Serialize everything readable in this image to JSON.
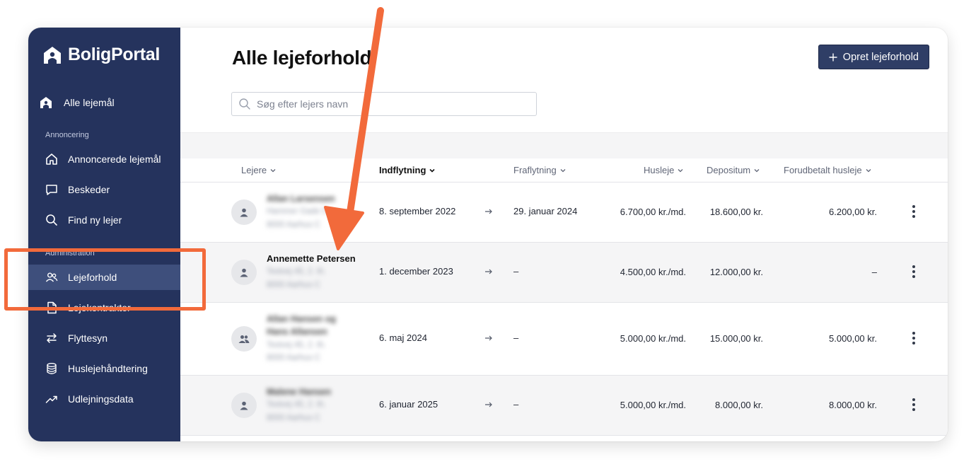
{
  "app": {
    "logo_text": "BoligPortal"
  },
  "sidebar": {
    "top_item": "Alle lejemål",
    "section_1": "Annoncering",
    "section_1_items": [
      "Annoncerede lejemål",
      "Beskeder",
      "Find ny lejer"
    ],
    "section_2": "Administration",
    "section_2_items": [
      "Lejeforhold",
      "Lejekontrakter",
      "Flyttesyn",
      "Huslejehåndtering",
      "Udlejningsdata"
    ]
  },
  "main": {
    "title": "Alle lejeforhold",
    "create_button": "Opret lejeforhold",
    "search_placeholder": "Søg efter lejers navn"
  },
  "table": {
    "columns": [
      "Lejere",
      "Indflytning",
      "Fraflytning",
      "Husleje",
      "Depositum",
      "Forudbetalt husleje"
    ],
    "rows": [
      {
        "name": "Allan Larsensen",
        "address1": "Hammer Gade 5",
        "address2": "8000 Aarhus C",
        "move_in": "8. september 2022",
        "move_out": "29. januar 2024",
        "rent": "6.700,00 kr./md.",
        "deposit": "18.600,00 kr.",
        "prepaid": "6.200,00 kr."
      },
      {
        "name": "Annemette Petersen",
        "address1": "Testvej 45, 2. th.",
        "address2": "8000 Aarhus C",
        "move_in": "1. december 2023",
        "move_out": "–",
        "rent": "4.500,00 kr./md.",
        "deposit": "12.000,00 kr.",
        "prepaid": "–"
      },
      {
        "name": "Allan Hansen og",
        "name2": "Hans Allansen",
        "address1": "Testvej 45, 2. th.",
        "address2": "8000 Aarhus C",
        "move_in": "6. maj 2024",
        "move_out": "–",
        "rent": "5.000,00 kr./md.",
        "deposit": "15.000,00 kr.",
        "prepaid": "5.000,00 kr."
      },
      {
        "name": "Malene Hansen",
        "address1": "Testvej 45, 2. th.",
        "address2": "8000 Aarhus C",
        "move_in": "6. januar 2025",
        "move_out": "–",
        "rent": "5.000,00 kr./md.",
        "deposit": "8.000,00 kr.",
        "prepaid": "8.000,00 kr."
      }
    ]
  },
  "colors": {
    "sidebar_bg": "#25335d",
    "active_item": "#3e4f7c",
    "annotation": "#f26a3b",
    "button_bg": "#2f3e66"
  }
}
